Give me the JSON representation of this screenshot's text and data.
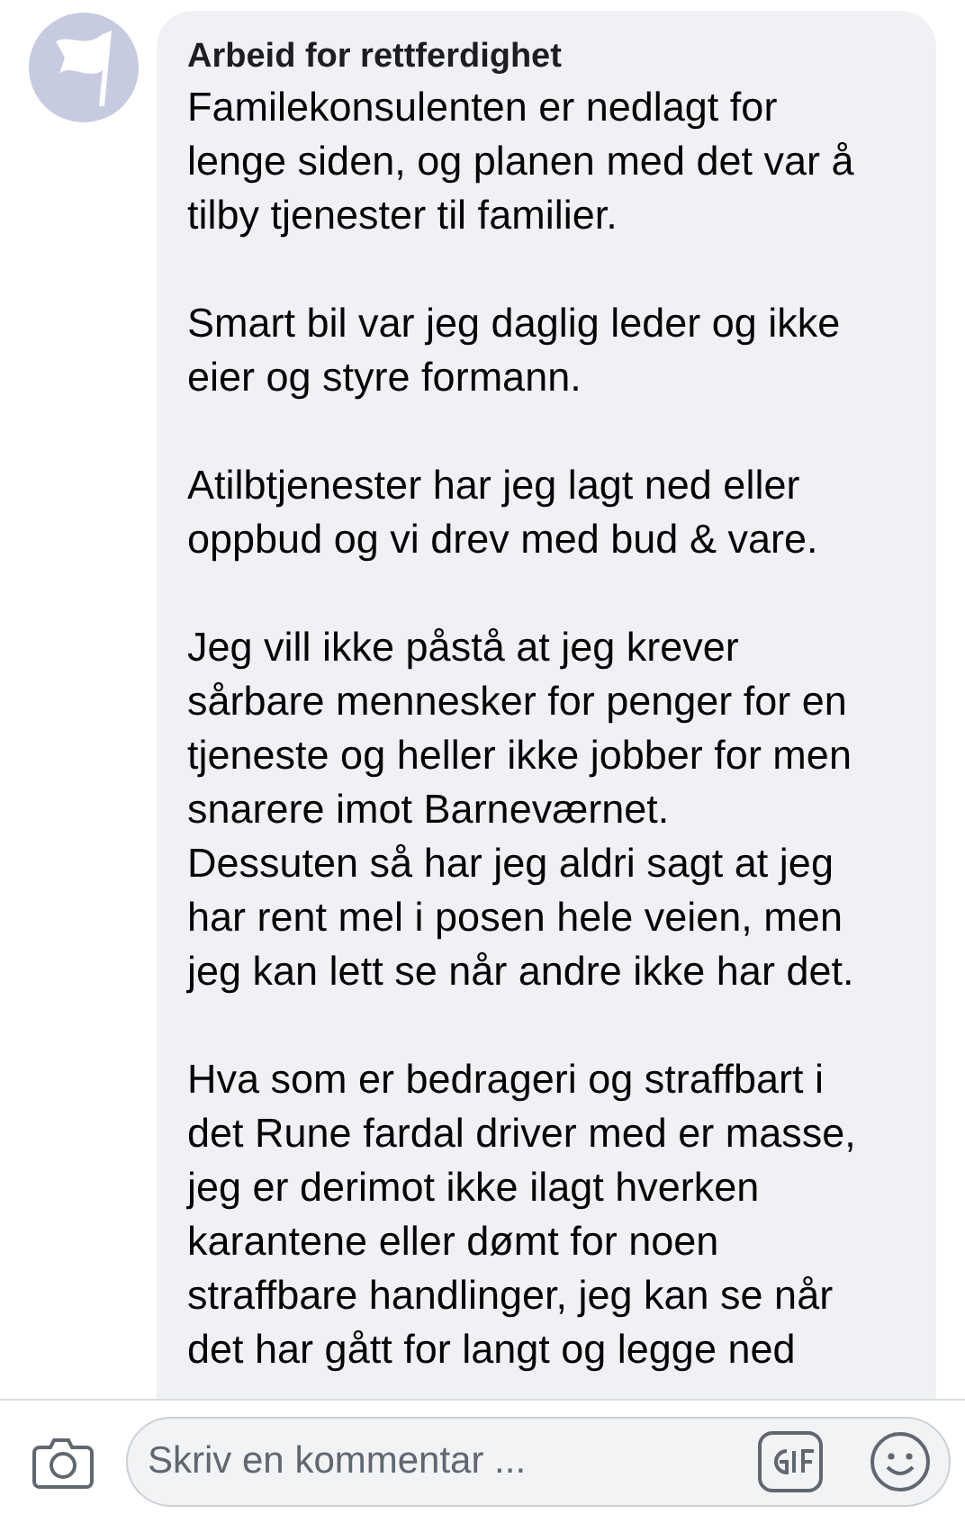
{
  "comment": {
    "author": "Arbeid for rettferdighet",
    "paragraphs": [
      "Familekonsulenten er nedlagt for\nlenge siden, og planen med det var å\ntilby tjenester til familier.",
      "Smart bil var jeg daglig leder og ikke\neier og styre formann.",
      "Atilbtjenester har jeg lagt ned eller\noppbud og vi drev med bud & vare.",
      "Jeg vill ikke påstå at jeg krever\nsårbare mennesker for penger for en\ntjeneste og heller ikke jobber for men\nsnarere imot Barneværnet.\nDessuten så har jeg aldri sagt at jeg\nhar rent mel i posen hele veien, men\njeg kan lett se når andre ikke har det.",
      "Hva som er bedrageri og straffbart i\ndet Rune fardal driver med er masse,\njeg er derimot ikke ilagt hverken\nkarantene eller dømt for noen\nstraffbare handlinger, jeg kan se når\ndet har gått for langt og legge ned"
    ]
  },
  "composer": {
    "placeholder": "Skriv en kommentar ..."
  }
}
